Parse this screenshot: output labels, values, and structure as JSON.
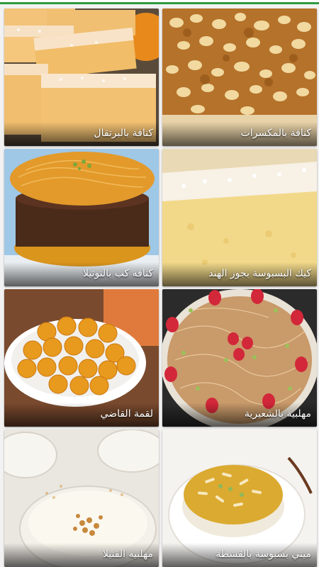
{
  "recipes": [
    {
      "title": "كنافة بالمكسرات"
    },
    {
      "title": "كنافة بالبرتقال"
    },
    {
      "title": "كيك البسبوسة بجوز الهند"
    },
    {
      "title": "كنافه كب بالنوتيلا"
    },
    {
      "title": "مهلبية بالشعيرية"
    },
    {
      "title": "لقمة القاضي"
    },
    {
      "title": "ميني بسبوسة بالقشطة"
    },
    {
      "title": "مهلبيه الفنيلا"
    }
  ],
  "colors": {
    "accent": "#2e9b3f",
    "caption_text": "#ffffff",
    "background": "#f2f2f2"
  }
}
